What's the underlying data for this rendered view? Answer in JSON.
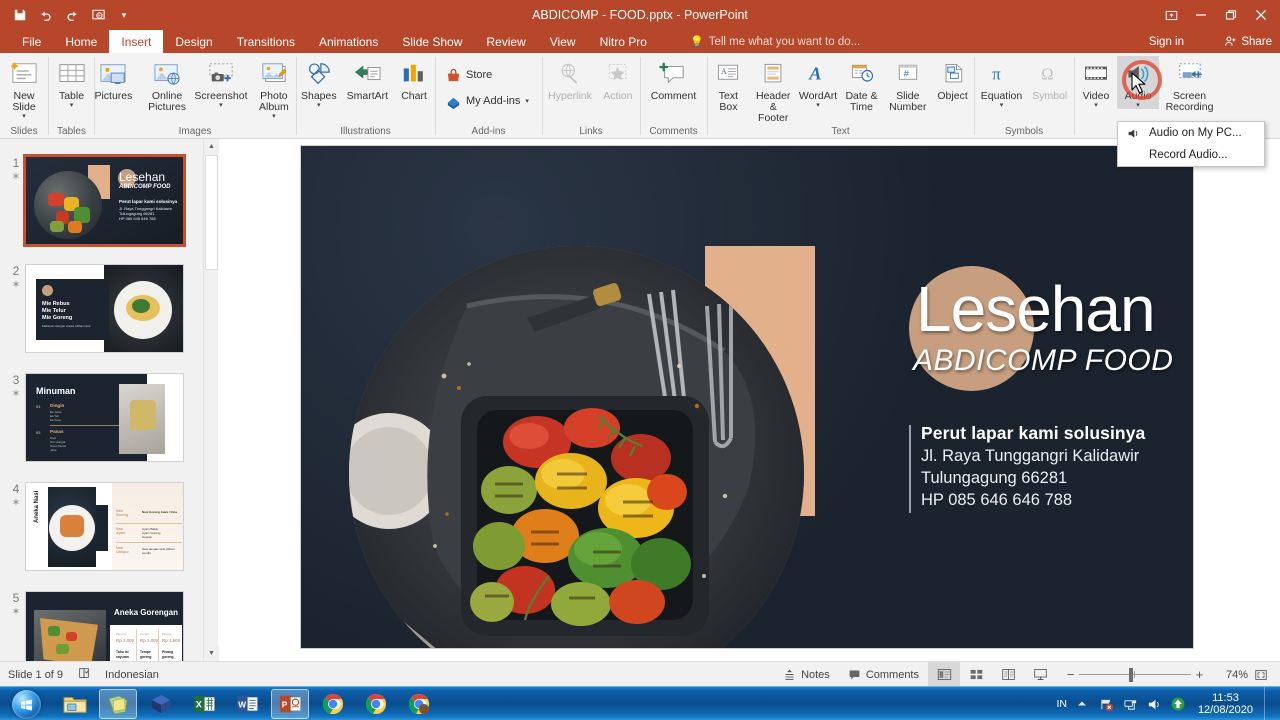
{
  "window": {
    "title": "ABDICOMP - FOOD.pptx - PowerPoint",
    "sign_in": "Sign in",
    "share": "Share",
    "quick_access": [
      "save-icon",
      "undo-icon",
      "redo-icon",
      "start-slideshow-icon",
      "customize-qat-icon"
    ],
    "controls": [
      "ribbon-display-options",
      "minimize",
      "restore",
      "close"
    ]
  },
  "tabs": [
    {
      "label": "File",
      "active": false
    },
    {
      "label": "Home",
      "active": false
    },
    {
      "label": "Insert",
      "active": true
    },
    {
      "label": "Design",
      "active": false
    },
    {
      "label": "Transitions",
      "active": false
    },
    {
      "label": "Animations",
      "active": false
    },
    {
      "label": "Slide Show",
      "active": false
    },
    {
      "label": "Review",
      "active": false
    },
    {
      "label": "View",
      "active": false
    },
    {
      "label": "Nitro Pro",
      "active": false
    }
  ],
  "tell_me": {
    "placeholder": "Tell me what you want to do..."
  },
  "ribbon": {
    "groups": [
      {
        "name": "Slides",
        "label": "Slides",
        "items": [
          {
            "label": "New Slide",
            "icon": "new-slide-icon",
            "dropdown": true
          }
        ]
      },
      {
        "name": "Tables",
        "label": "Tables",
        "items": [
          {
            "label": "Table",
            "icon": "table-icon",
            "dropdown": true
          }
        ]
      },
      {
        "name": "Images",
        "label": "Images",
        "items": [
          {
            "label": "Pictures",
            "icon": "pictures-icon",
            "dropdown": false
          },
          {
            "label": "Online Pictures",
            "icon": "online-pictures-icon",
            "dropdown": false
          },
          {
            "label": "Screenshot",
            "icon": "screenshot-icon",
            "dropdown": true
          },
          {
            "label": "Photo Album",
            "icon": "photo-album-icon",
            "dropdown": true
          }
        ]
      },
      {
        "name": "Illustrations",
        "label": "Illustrations",
        "items": [
          {
            "label": "Shapes",
            "icon": "shapes-icon",
            "dropdown": true
          },
          {
            "label": "SmartArt",
            "icon": "smartart-icon",
            "dropdown": false
          },
          {
            "label": "Chart",
            "icon": "chart-icon",
            "dropdown": false
          }
        ]
      },
      {
        "name": "Add-ins",
        "label": "Add-ins",
        "items": [
          {
            "label": "Store",
            "icon": "store-icon",
            "dropdown": false
          },
          {
            "label": "My Add-ins",
            "icon": "my-addins-icon",
            "dropdown": true
          }
        ]
      },
      {
        "name": "Links",
        "label": "Links",
        "items": [
          {
            "label": "Hyperlink",
            "icon": "hyperlink-icon",
            "disabled": true
          },
          {
            "label": "Action",
            "icon": "action-icon",
            "disabled": true
          }
        ]
      },
      {
        "name": "Comments",
        "label": "Comments",
        "items": [
          {
            "label": "Comment",
            "icon": "comment-icon",
            "dropdown": false
          }
        ]
      },
      {
        "name": "Text",
        "label": "Text",
        "items": [
          {
            "label": "Text Box",
            "icon": "text-box-icon",
            "dropdown": false
          },
          {
            "label": "Header & Footer",
            "icon": "header-footer-icon",
            "dropdown": false
          },
          {
            "label": "WordArt",
            "icon": "wordart-icon",
            "dropdown": true
          },
          {
            "label": "Date & Time",
            "icon": "date-time-icon",
            "dropdown": false
          },
          {
            "label": "Slide Number",
            "icon": "slide-number-icon",
            "dropdown": false
          },
          {
            "label": "Object",
            "icon": "object-icon",
            "dropdown": false
          }
        ]
      },
      {
        "name": "Symbols",
        "label": "Symbols",
        "items": [
          {
            "label": "Equation",
            "icon": "equation-icon",
            "dropdown": true
          },
          {
            "label": "Symbol",
            "icon": "symbol-icon",
            "disabled": true
          }
        ]
      },
      {
        "name": "Media",
        "label": "",
        "items": [
          {
            "label": "Video",
            "icon": "video-icon",
            "dropdown": true
          },
          {
            "label": "Audio",
            "icon": "audio-icon",
            "dropdown": true,
            "highlighted": true
          },
          {
            "label": "Screen Recording",
            "icon": "screen-recording-icon",
            "dropdown": false
          }
        ]
      }
    ]
  },
  "audio_menu": {
    "open": true,
    "items": [
      {
        "label": "Audio on My PC...",
        "icon": "speaker-icon"
      },
      {
        "label": "Record Audio...",
        "icon": ""
      }
    ]
  },
  "slide_panel": {
    "selected": 1,
    "thumbnails": [
      {
        "number": "1",
        "title": "Lesehan",
        "subtitle": "ABDICOMP FOOD",
        "style": "hero"
      },
      {
        "number": "2",
        "title": "Mie Rebus / Mie Telur / Mie Goreng",
        "style": "menu-left"
      },
      {
        "number": "3",
        "title": "Minuman",
        "style": "drinks"
      },
      {
        "number": "4",
        "title": "Aneka Nasi",
        "style": "rice"
      },
      {
        "number": "5",
        "title": "Aneka Gorengan",
        "style": "fried"
      }
    ]
  },
  "slide": {
    "title": "Lesehan",
    "subtitle": "ABDICOMP FOOD",
    "tagline": "Perut lapar kami solusinya",
    "address_line1": "Jl. Raya Tunggangri Kalidawir",
    "address_line2": "Tulungagung 66281",
    "phone": "HP 085 646 646 788",
    "colors": {
      "background": "#1c2430",
      "accent": "#c79f80",
      "peach": "#e2b18c"
    }
  },
  "status_bar": {
    "slide_counter": "Slide 1 of 9",
    "language": "Indonesian",
    "notes": "Notes",
    "comments": "Comments",
    "zoom_percent": "74%",
    "views": [
      "normal-view",
      "slide-sorter-view",
      "reading-view",
      "slide-show-view"
    ]
  },
  "taskbar": {
    "apps": [
      {
        "name": "windows-explorer",
        "running": false
      },
      {
        "name": "sticky-notes",
        "running": true
      },
      {
        "name": "virtualbox",
        "running": false
      },
      {
        "name": "excel",
        "running": false
      },
      {
        "name": "word",
        "running": false
      },
      {
        "name": "powerpoint",
        "running": true
      },
      {
        "name": "chrome-1",
        "running": false
      },
      {
        "name": "chrome-2",
        "running": false
      },
      {
        "name": "chrome-3",
        "running": false
      }
    ],
    "tray": {
      "language": "IN",
      "time": "11:53",
      "date": "12/08/2020",
      "icons": [
        "show-hidden-icon",
        "action-center-icon",
        "network-icon",
        "volume-icon",
        "update-icon"
      ]
    }
  }
}
